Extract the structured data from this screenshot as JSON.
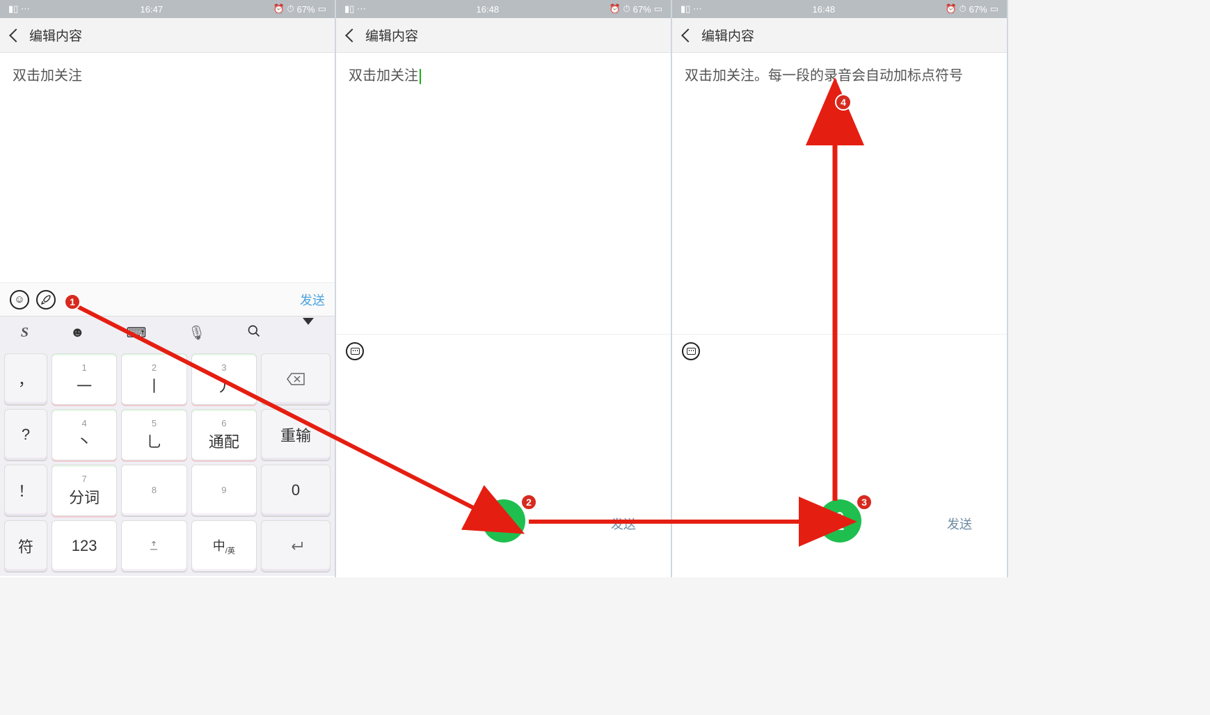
{
  "status": {
    "time1": "16:47",
    "time2": "16:48",
    "time3": "16:48",
    "battery": "67%",
    "signal_icons": "⫾⫾ ⋯"
  },
  "nav": {
    "title": "编辑内容"
  },
  "content": {
    "text1": "双击加关注",
    "text2": "双击加关注",
    "text3": "双击加关注。每一段的录音会自动加标点符号"
  },
  "toolbar": {
    "send": "发送"
  },
  "ime": {
    "logo": "S",
    "emoji": "☻",
    "kb": "⌨",
    "mic": "🎤",
    "search": "🔍",
    "dropdown": "▼"
  },
  "keys": {
    "row1": {
      "side": "，",
      "k1n": "1",
      "k1": "一",
      "k2n": "2",
      "k2": "丨",
      "k3n": "3",
      "k3": "丿",
      "right": "⌫"
    },
    "row2": {
      "side": "?",
      "k1n": "4",
      "k1": "丶",
      "k2n": "5",
      "k2": "乚",
      "k3n": "6",
      "k3": "通配",
      "right": "重输"
    },
    "row3": {
      "side": "！",
      "k1n": "7",
      "k1": "分词",
      "k2n": "8",
      "k2": "",
      "k3n": "9",
      "k3": "",
      "right": "0"
    },
    "row4": {
      "side": "符",
      "k1": "123",
      "k2": "␣",
      "k3": "中/英",
      "right": "↲"
    }
  },
  "badges": {
    "b1": "1",
    "b2": "2",
    "b3": "3",
    "b4": "4"
  },
  "lower": {
    "send": "发送"
  }
}
